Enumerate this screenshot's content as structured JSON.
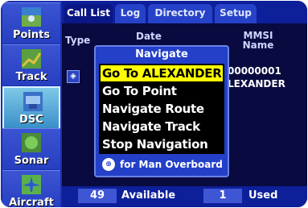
{
  "sidebar": {
    "items": [
      {
        "label": "Points",
        "icon": "points-icon"
      },
      {
        "label": "Track",
        "icon": "track-icon"
      },
      {
        "label": "DSC",
        "icon": "dsc-icon",
        "selected": true
      },
      {
        "label": "Sonar",
        "icon": "sonar-icon"
      },
      {
        "label": "Aircraft",
        "icon": "aircraft-icon"
      }
    ]
  },
  "tabs": [
    "Call List",
    "Log",
    "Directory",
    "Setup"
  ],
  "columns": {
    "type": "Type",
    "date": "Date",
    "mmsi_line1": "MMSI",
    "mmsi_line2": "Name"
  },
  "row": {
    "mmsi": "00000001",
    "name": "LEXANDER"
  },
  "footer": {
    "available_count": "49",
    "available_label": "Available",
    "used_count": "1",
    "used_label": "Used"
  },
  "popup": {
    "title": "Navigate",
    "items": [
      "Go To ALEXANDER",
      "Go To Point",
      "Navigate Route",
      "Navigate Track",
      "Stop Navigation"
    ],
    "selected_index": 0,
    "hint_key": "⊕",
    "hint": "for Man Overboard"
  },
  "colors": {
    "highlight": "#ffff00",
    "accent": "#2440c8"
  }
}
